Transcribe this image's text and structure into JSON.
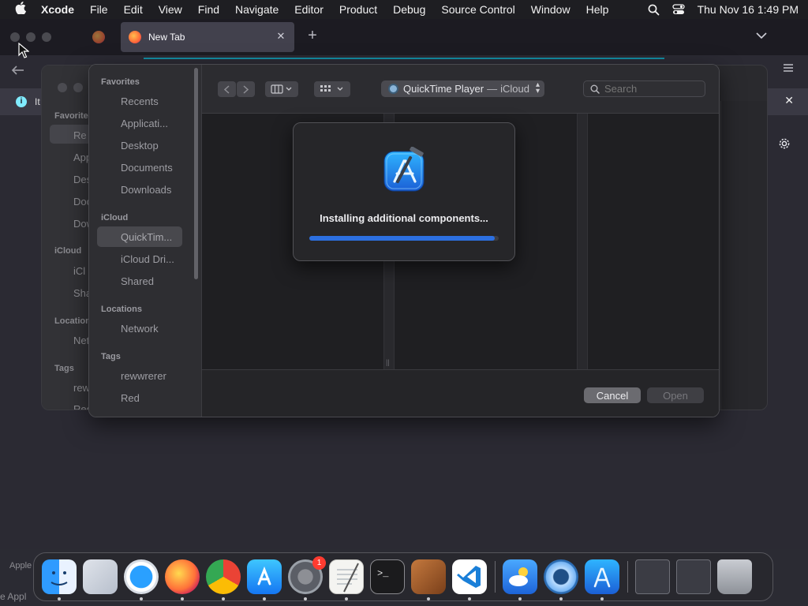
{
  "menubar": {
    "app": "Xcode",
    "items": [
      "File",
      "Edit",
      "View",
      "Find",
      "Navigate",
      "Editor",
      "Product",
      "Debug",
      "Source Control",
      "Window",
      "Help"
    ],
    "clock": "Thu Nov 16  1:49 PM"
  },
  "browser": {
    "tab_title": "New Tab",
    "notification_text": "It",
    "bottom_text_1": "Apple",
    "bottom_text_2": "e Appl"
  },
  "back_panel": {
    "sections": {
      "favorites": "Favorites",
      "icloud": "iCloud",
      "locations": "Location",
      "tags": "Tags"
    },
    "items": [
      "Re",
      "App",
      "Des",
      "Doc",
      "Dow",
      "iCl",
      "Sha",
      "Net",
      "rew",
      "Red"
    ]
  },
  "open_panel": {
    "sidebar": {
      "favorites_header": "Favorites",
      "favorites": [
        "Recents",
        "Applicati...",
        "Desktop",
        "Documents",
        "Downloads"
      ],
      "icloud_header": "iCloud",
      "icloud": [
        "QuickTim...",
        "iCloud Dri...",
        "Shared"
      ],
      "locations_header": "Locations",
      "locations": [
        "Network"
      ],
      "tags_header": "Tags",
      "tags": [
        "rewwrerer",
        "Red"
      ]
    },
    "location": {
      "name": "QuickTime Player",
      "separator": "—",
      "sub": "iCloud"
    },
    "search_placeholder": "Search",
    "cancel_label": "Cancel",
    "open_label": "Open"
  },
  "progress_sheet": {
    "message": "Installing additional components...",
    "progress": 0.98
  },
  "dock": {
    "items": [
      {
        "name": "finder-icon",
        "running": true
      },
      {
        "name": "launchpad-icon",
        "running": false
      },
      {
        "name": "safari-icon",
        "running": true
      },
      {
        "name": "firefox-icon",
        "running": true
      },
      {
        "name": "chrome-icon",
        "running": true
      },
      {
        "name": "app-store-icon",
        "running": true
      },
      {
        "name": "system-settings-icon",
        "running": true,
        "badge": "1"
      },
      {
        "name": "textedit-icon",
        "running": true
      },
      {
        "name": "terminal-icon",
        "running": false
      },
      {
        "name": "garageband-icon",
        "running": true
      },
      {
        "name": "vscode-icon",
        "running": true
      },
      {
        "name": "weather-icon",
        "running": true
      },
      {
        "name": "quicktime-icon",
        "running": true
      },
      {
        "name": "xcode-icon",
        "running": true
      },
      {
        "name": "window-thumbnail-icon",
        "running": false
      },
      {
        "name": "window-thumbnail-icon",
        "running": false
      },
      {
        "name": "trash-icon",
        "running": false
      }
    ]
  },
  "colors": {
    "accent": "#2c6fe0",
    "menubar": "#1e1e22",
    "panel": "#252528"
  }
}
